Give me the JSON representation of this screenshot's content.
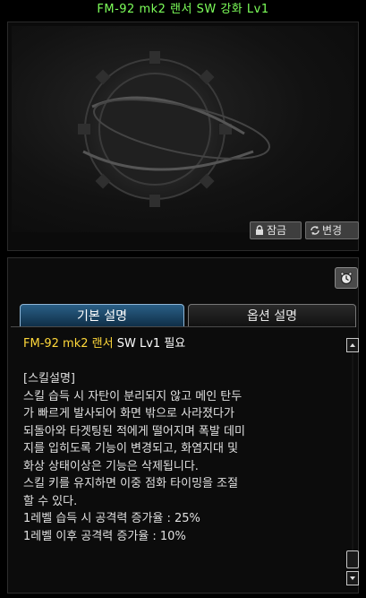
{
  "title": "FM-92 mk2 랜서 SW 강화 Lv1",
  "preview": {
    "lock_label": "잠금",
    "change_label": "변경"
  },
  "tabs": [
    {
      "label": "기본 설명",
      "active": true
    },
    {
      "label": "옵션 설명",
      "active": false
    }
  ],
  "requirement": {
    "item": "FM-92 mk2 랜서",
    "rest": "SW Lv1",
    "suffix": "필요"
  },
  "description": {
    "heading": "[스킬설명]",
    "lines": [
      "스킬 습득 시 자탄이 분리되지 않고 메인 탄두",
      "가 빠르게 발사되어 화면 밖으로 사라졌다가",
      "되돌아와 타겟팅된 적에게 떨어지며 폭발 데미",
      "지를 입히도록 기능이 변경되고, 화염지대 및",
      "화상 상태이상은 기능은 삭제됩니다.",
      "스킬 키를 유지하면 이중 점화 타이밍을 조절",
      "할 수 있다.",
      "1레벨 습득 시 공격력 증가율 : 25%",
      "1레벨 이후 공격력 증가율 : 10%"
    ]
  },
  "colors": {
    "title": "#7dff5a",
    "requirement": "#ffd83a",
    "active_tab": "#1d4a6e"
  },
  "icons": [
    "lock-icon",
    "change-icon",
    "clock-icon",
    "scroll-up-icon",
    "scroll-down-icon"
  ]
}
